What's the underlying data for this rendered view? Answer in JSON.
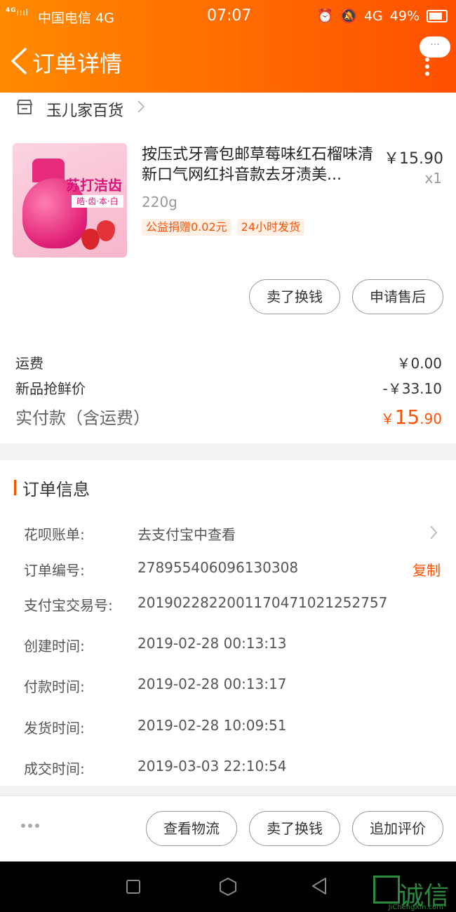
{
  "status_bar": {
    "signal": "4G",
    "carrier": "中国电信 4G",
    "time": "07:07",
    "network": "4G",
    "battery": "49%"
  },
  "nav": {
    "title": "订单详情",
    "bubble": "···"
  },
  "store": {
    "name": "玉儿家百货"
  },
  "product": {
    "title": "按压式牙膏包邮草莓味红石榴味清新口气网红抖音款去牙渍美...",
    "price": "￥15.90",
    "qty": "x1",
    "sku": "220g",
    "tags": [
      "公益捐赠0.02元",
      "24小时发货"
    ],
    "image_text": {
      "label": "苏打洁齿",
      "sub": "皓·齿·本·白"
    },
    "buttons": {
      "sell": "卖了换钱",
      "after_sale": "申请售后"
    }
  },
  "summary": {
    "shipping_label": "运费",
    "shipping_value": "￥0.00",
    "discount_label": "新品抢鲜价",
    "discount_value": "-￥33.10",
    "paid_label": "实付款（含运费）",
    "paid_currency": "￥",
    "paid_int": "15",
    "paid_dec": ".90"
  },
  "order_info": {
    "title": "订单信息",
    "huabei_label": "花呗账单:",
    "huabei_value": "去支付宝中查看",
    "order_no_label": "订单编号:",
    "order_no_value": "278955406096130308",
    "copy": "复制",
    "alipay_label": "支付宝交易号:",
    "alipay_value": "2019022822001170471021252757",
    "created_label": "创建时间:",
    "created_value": "2019-02-28 00:13:13",
    "paid_label": "付款时间:",
    "paid_value": "2019-02-28 00:13:17",
    "shipped_label": "发货时间:",
    "shipped_value": "2019-02-28 10:09:51",
    "deal_label": "成交时间:",
    "deal_value": "2019-03-03 22:10:54"
  },
  "bottom_actions": {
    "logistics": "查看物流",
    "sell": "卖了换钱",
    "review": "追加评价"
  },
  "watermark": {
    "text": "诚信",
    "sub": "JiChengXin.com"
  },
  "colors": {
    "accent": "#ff5000",
    "header_start": "#ff8a00",
    "header_end": "#ff5000"
  }
}
